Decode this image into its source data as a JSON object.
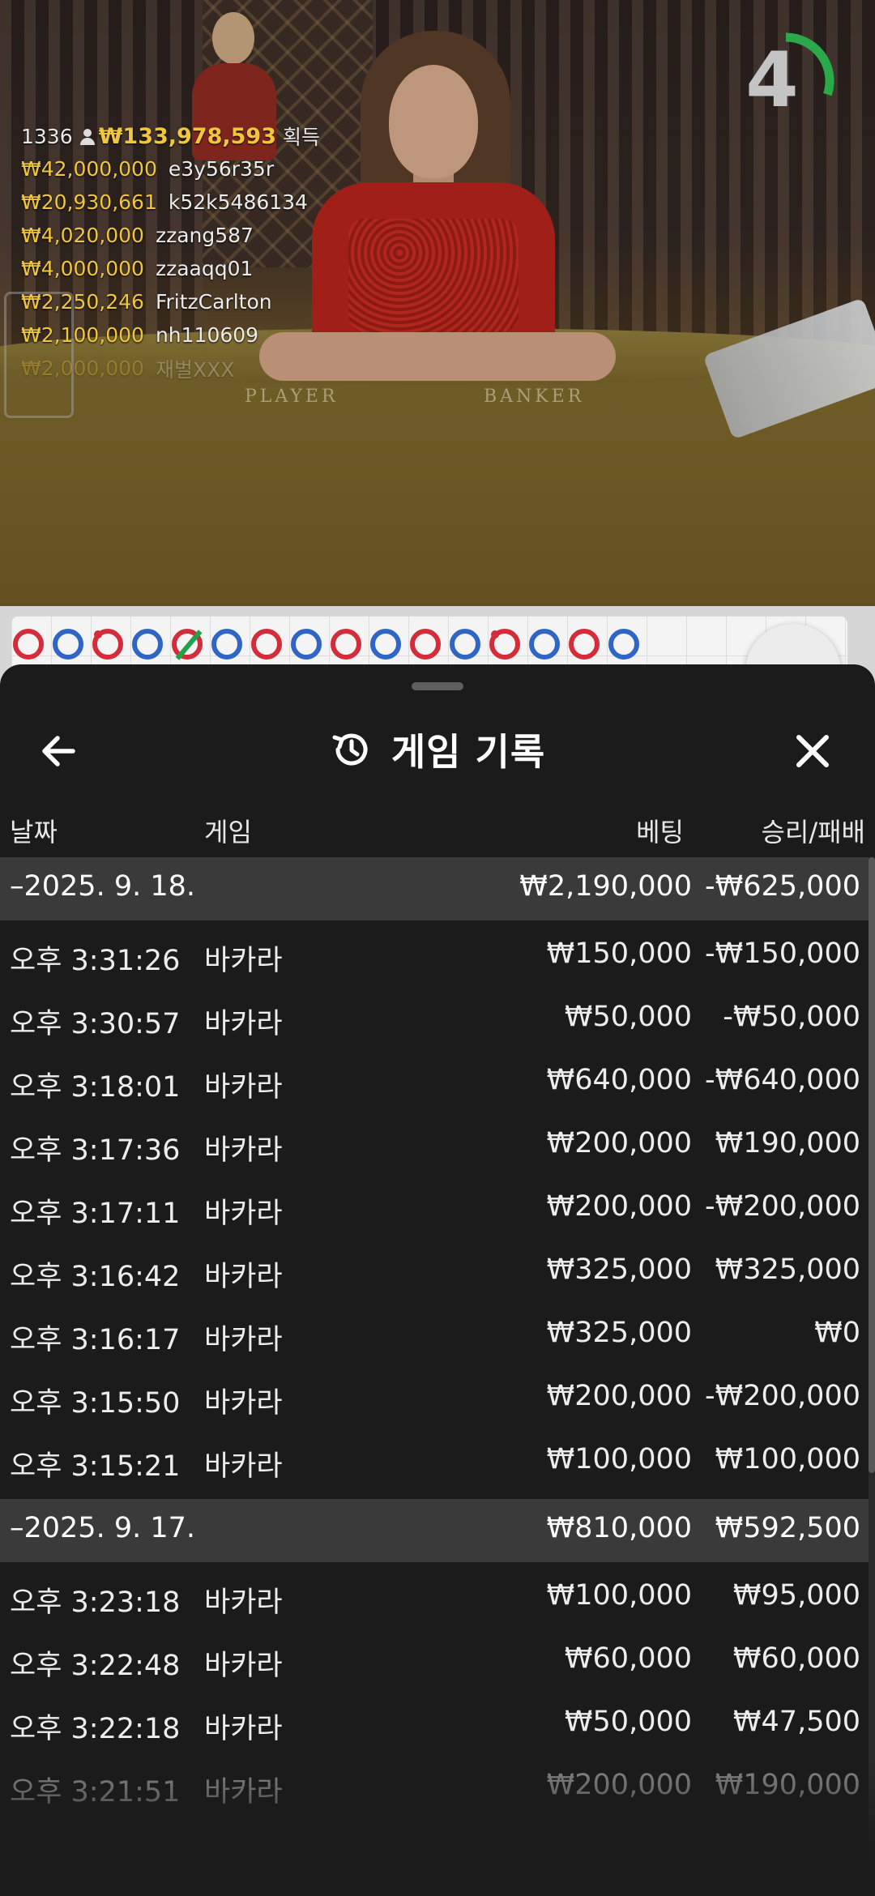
{
  "leaderboard": {
    "player_count": "1336",
    "total_won": "₩133,978,593",
    "won_label": "획득",
    "winners": [
      {
        "amount": "₩42,000,000",
        "user": "e3y56r35r"
      },
      {
        "amount": "₩20,930,661",
        "user": "k52k5486134"
      },
      {
        "amount": "₩4,020,000",
        "user": "zzang587"
      },
      {
        "amount": "₩4,000,000",
        "user": "zzaaqq01"
      },
      {
        "amount": "₩2,250,246",
        "user": "FritzCarlton"
      },
      {
        "amount": "₩2,100,000",
        "user": "nh110609"
      },
      {
        "amount": "₩2,000,000",
        "user": "재벌XXX"
      }
    ]
  },
  "timer": {
    "seconds": "4",
    "progress": 0.3
  },
  "table_labels": {
    "player": "PLAYER",
    "banker": "BANKER"
  },
  "bead_road": [
    "r",
    "b",
    "r",
    "b",
    "r",
    "b",
    "r",
    "b",
    "r",
    "b",
    "r",
    "b",
    "r",
    "b",
    "r",
    "b"
  ],
  "colors": {
    "banker": "#d42c3a",
    "player": "#2f66c5",
    "tie": "#21a14a",
    "timer": "#2aa84a",
    "gold": "#f0c63c"
  },
  "history": {
    "title": "게임 기록",
    "columns": {
      "date": "날짜",
      "game": "게임",
      "bet": "베팅",
      "result": "승리/패배"
    },
    "groups": [
      {
        "date": "–2025. 9. 18.",
        "bet": "₩2,190,000",
        "result": "-₩625,000",
        "rows": [
          {
            "time": "오후 3:31:26",
            "game": "바카라",
            "bet": "₩150,000",
            "result": "-₩150,000"
          },
          {
            "time": "오후 3:30:57",
            "game": "바카라",
            "bet": "₩50,000",
            "result": "-₩50,000"
          },
          {
            "time": "오후 3:18:01",
            "game": "바카라",
            "bet": "₩640,000",
            "result": "-₩640,000"
          },
          {
            "time": "오후 3:17:36",
            "game": "바카라",
            "bet": "₩200,000",
            "result": "₩190,000"
          },
          {
            "time": "오후 3:17:11",
            "game": "바카라",
            "bet": "₩200,000",
            "result": "-₩200,000"
          },
          {
            "time": "오후 3:16:42",
            "game": "바카라",
            "bet": "₩325,000",
            "result": "₩325,000"
          },
          {
            "time": "오후 3:16:17",
            "game": "바카라",
            "bet": "₩325,000",
            "result": "₩0"
          },
          {
            "time": "오후 3:15:50",
            "game": "바카라",
            "bet": "₩200,000",
            "result": "-₩200,000"
          },
          {
            "time": "오후 3:15:21",
            "game": "바카라",
            "bet": "₩100,000",
            "result": "₩100,000"
          }
        ]
      },
      {
        "date": "–2025. 9. 17.",
        "bet": "₩810,000",
        "result": "₩592,500",
        "rows": [
          {
            "time": "오후 3:23:18",
            "game": "바카라",
            "bet": "₩100,000",
            "result": "₩95,000"
          },
          {
            "time": "오후 3:22:48",
            "game": "바카라",
            "bet": "₩60,000",
            "result": "₩60,000"
          },
          {
            "time": "오후 3:22:18",
            "game": "바카라",
            "bet": "₩50,000",
            "result": "₩47,500"
          },
          {
            "time": "오후 3:21:51",
            "game": "바카라",
            "bet": "₩200,000",
            "result": "₩190,000"
          }
        ]
      }
    ]
  }
}
